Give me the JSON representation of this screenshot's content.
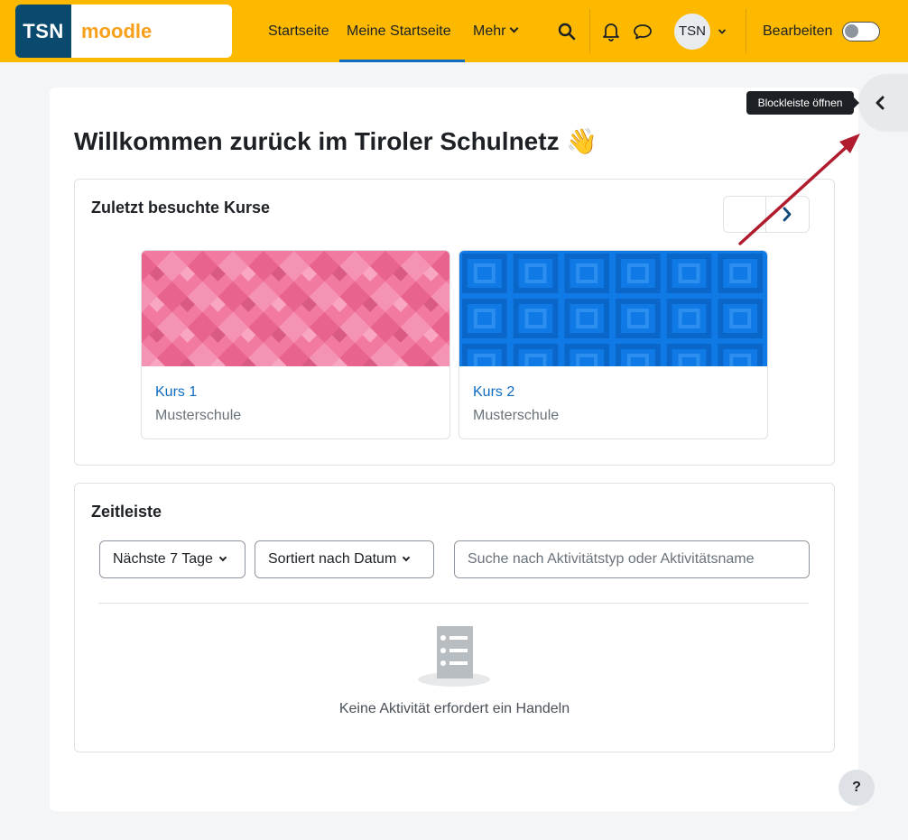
{
  "logo": {
    "tsn": "TSN",
    "moodle": "moodle"
  },
  "nav": {
    "home": "Startseite",
    "dashboard": "Meine Startseite",
    "more": "Mehr",
    "avatar_initials": "TSN",
    "edit_label": "Bearbeiten",
    "edit_mode": false
  },
  "page": {
    "welcome": "Willkommen zurück im Tiroler Schulnetz 👋"
  },
  "recent_courses": {
    "title": "Zuletzt besuchte Kurse",
    "courses": [
      {
        "name": "Kurs 1",
        "school": "Musterschule",
        "color": "#f27aa0"
      },
      {
        "name": "Kurs 2",
        "school": "Musterschule",
        "color": "#0f7ae5"
      }
    ]
  },
  "timeline": {
    "title": "Zeitleiste",
    "filter_days": "Nächste 7 Tage",
    "sort": "Sortiert nach Datum",
    "search_placeholder": "Suche nach Aktivitätstyp oder Aktivitätsname",
    "empty_message": "Keine Aktivität erfordert ein Handeln"
  },
  "drawer": {
    "tooltip": "Blockleiste öffnen"
  },
  "help": {
    "label": "?"
  },
  "colors": {
    "navbar": "#fcb900",
    "link": "#0f6cbf",
    "annotation_arrow": "#b01c2e"
  }
}
